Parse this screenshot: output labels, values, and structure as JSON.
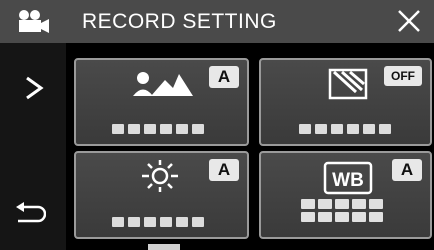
{
  "header": {
    "title": "RECORD SETTING",
    "mode_icon": "video-camera-icon",
    "close_icon": "close-icon"
  },
  "nav": {
    "next_icon": "chevron-right-icon",
    "back_icon": "return-arrow-icon"
  },
  "tiles": [
    {
      "name": "scene-select",
      "icon": "scene-mountain-portrait-icon",
      "badge": "A"
    },
    {
      "name": "backlight-compensation",
      "icon": "backlight-icon",
      "badge": "OFF"
    },
    {
      "name": "brightness",
      "icon": "sun-brightness-icon",
      "badge": "A"
    },
    {
      "name": "white-balance",
      "icon": "wb-icon",
      "icon_text": "WB",
      "badge": "A"
    }
  ],
  "colors": {
    "header_bg": "#4a4a4a",
    "tile_bg": "#404040",
    "tile_border": "#9a9a9a",
    "badge_bg": "#e8e8e8"
  }
}
